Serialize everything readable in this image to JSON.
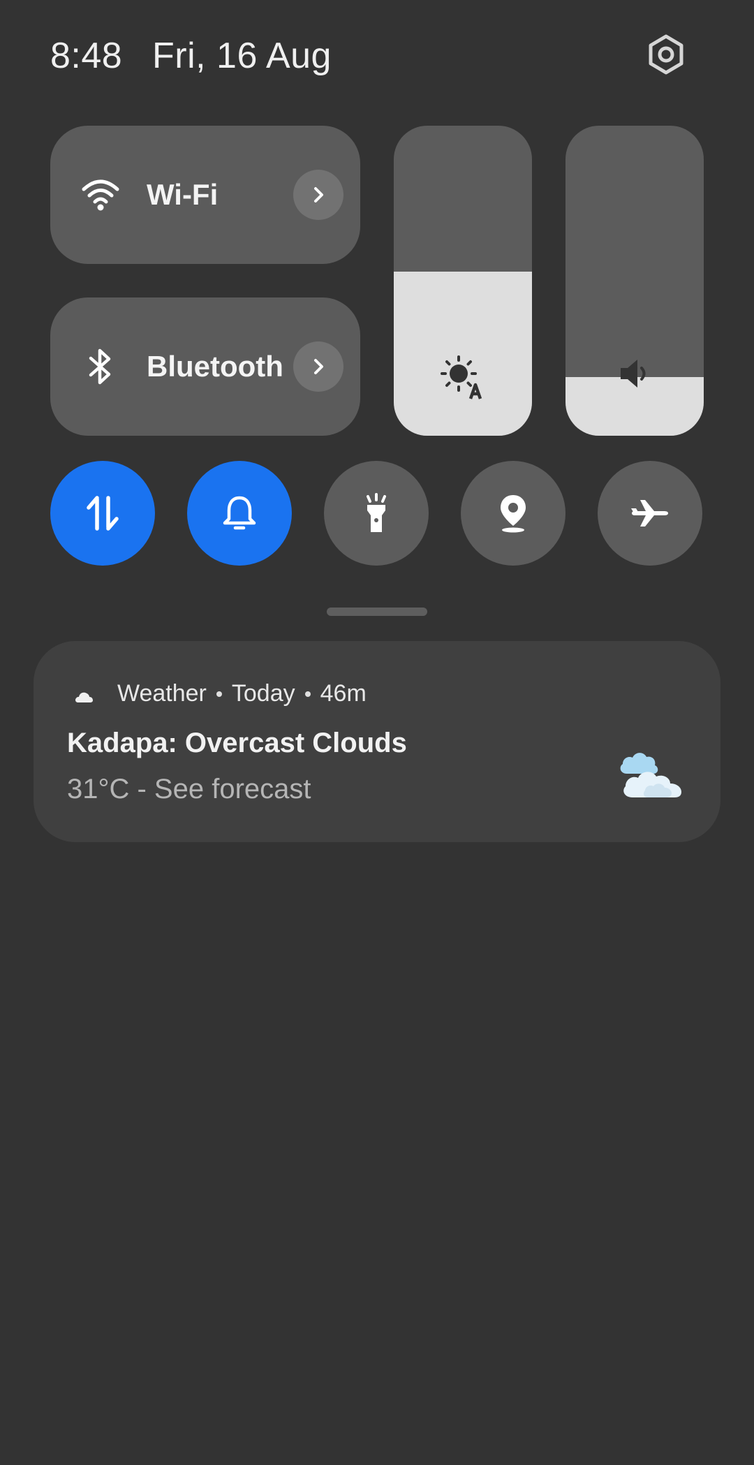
{
  "status": {
    "time": "8:48",
    "date": "Fri, 16 Aug",
    "settings_icon": "settings-gear-icon"
  },
  "tiles": {
    "wifi": {
      "label": "Wi-Fi",
      "icon": "wifi-icon"
    },
    "bluetooth": {
      "label": "Bluetooth",
      "icon": "bluetooth-icon"
    }
  },
  "sliders": {
    "brightness": {
      "icon": "auto-brightness-icon",
      "level_fraction": 0.53
    },
    "volume": {
      "icon": "volume-icon",
      "level_fraction": 0.19
    }
  },
  "quick_buttons": [
    {
      "name": "mobile-data",
      "icon": "data-arrows-icon",
      "active": true
    },
    {
      "name": "sound",
      "icon": "bell-icon",
      "active": true
    },
    {
      "name": "flashlight",
      "icon": "flashlight-icon",
      "active": false
    },
    {
      "name": "location",
      "icon": "location-pin-icon",
      "active": false
    },
    {
      "name": "airplane-mode",
      "icon": "airplane-icon",
      "active": false
    }
  ],
  "notification": {
    "app": "Weather",
    "when": "Today",
    "age": "46m",
    "title": "Kadapa: Overcast Clouds",
    "subtitle": "31°C - See forecast",
    "image_icon": "overcast-clouds-icon"
  },
  "colors": {
    "background": "#333333",
    "active_accent": "#1a73f0",
    "tile_bg": "#5b5b5b",
    "slider_fill": "#dedede"
  }
}
